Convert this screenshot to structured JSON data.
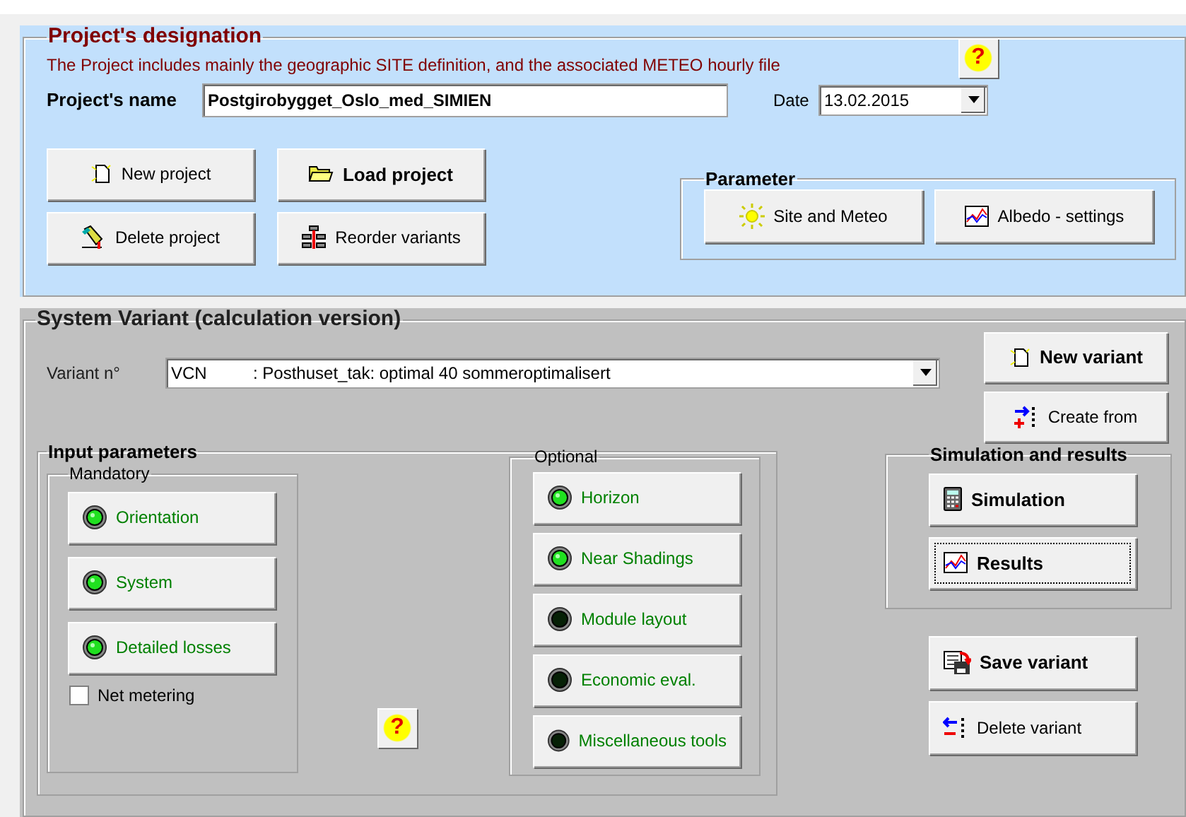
{
  "project": {
    "title": "Project's designation",
    "description": "The Project includes mainly the geographic SITE definition, and the associated  METEO  hourly file",
    "help": "?",
    "name_label": "Project's name",
    "name_value": "Postgirobygget_Oslo_med_SIMIEN",
    "date_label": "Date",
    "date_value": "13.02.2015",
    "buttons": [
      {
        "label": "New project",
        "bold": false
      },
      {
        "label": "Load project",
        "bold": true
      },
      {
        "label": "Delete project",
        "bold": false
      },
      {
        "label": "Reorder variants",
        "bold": false
      }
    ],
    "parameter": {
      "title": "Parameter",
      "buttons": [
        {
          "label": "Site and Meteo",
          "bold": false
        },
        {
          "label": "Albedo - settings",
          "bold": false
        }
      ]
    }
  },
  "variant": {
    "title": "System Variant (calculation version)",
    "number_label": "Variant n°",
    "code": "VCN",
    "description": ": Posthuset_tak: optimal 40 sommeroptimalisert",
    "buttons": [
      {
        "label": "New variant",
        "bold": true
      },
      {
        "label": "Create from",
        "bold": false
      }
    ],
    "input_parameters": {
      "title": "Input parameters",
      "help": "?",
      "mandatory": {
        "title": "Mandatory",
        "items": [
          {
            "label": "Orientation",
            "lit": true
          },
          {
            "label": "System",
            "lit": true
          },
          {
            "label": "Detailed losses",
            "lit": true
          }
        ],
        "net_metering": {
          "label": "Net metering",
          "checked": false
        }
      },
      "optional": {
        "title": "Optional",
        "items": [
          {
            "label": "Horizon",
            "lit": true
          },
          {
            "label": "Near Shadings",
            "lit": true
          },
          {
            "label": "Module layout",
            "lit": false
          },
          {
            "label": "Economic eval.",
            "lit": false
          },
          {
            "label": "Miscellaneous tools",
            "lit": false
          }
        ]
      }
    },
    "simulation": {
      "title": "Simulation and results",
      "buttons": [
        {
          "label": "Simulation",
          "bold": true,
          "focused": false
        },
        {
          "label": "Results",
          "bold": true,
          "focused": true
        }
      ]
    },
    "actions": [
      {
        "label": "Save variant",
        "bold": true
      },
      {
        "label": "Delete variant",
        "bold": false
      }
    ]
  }
}
